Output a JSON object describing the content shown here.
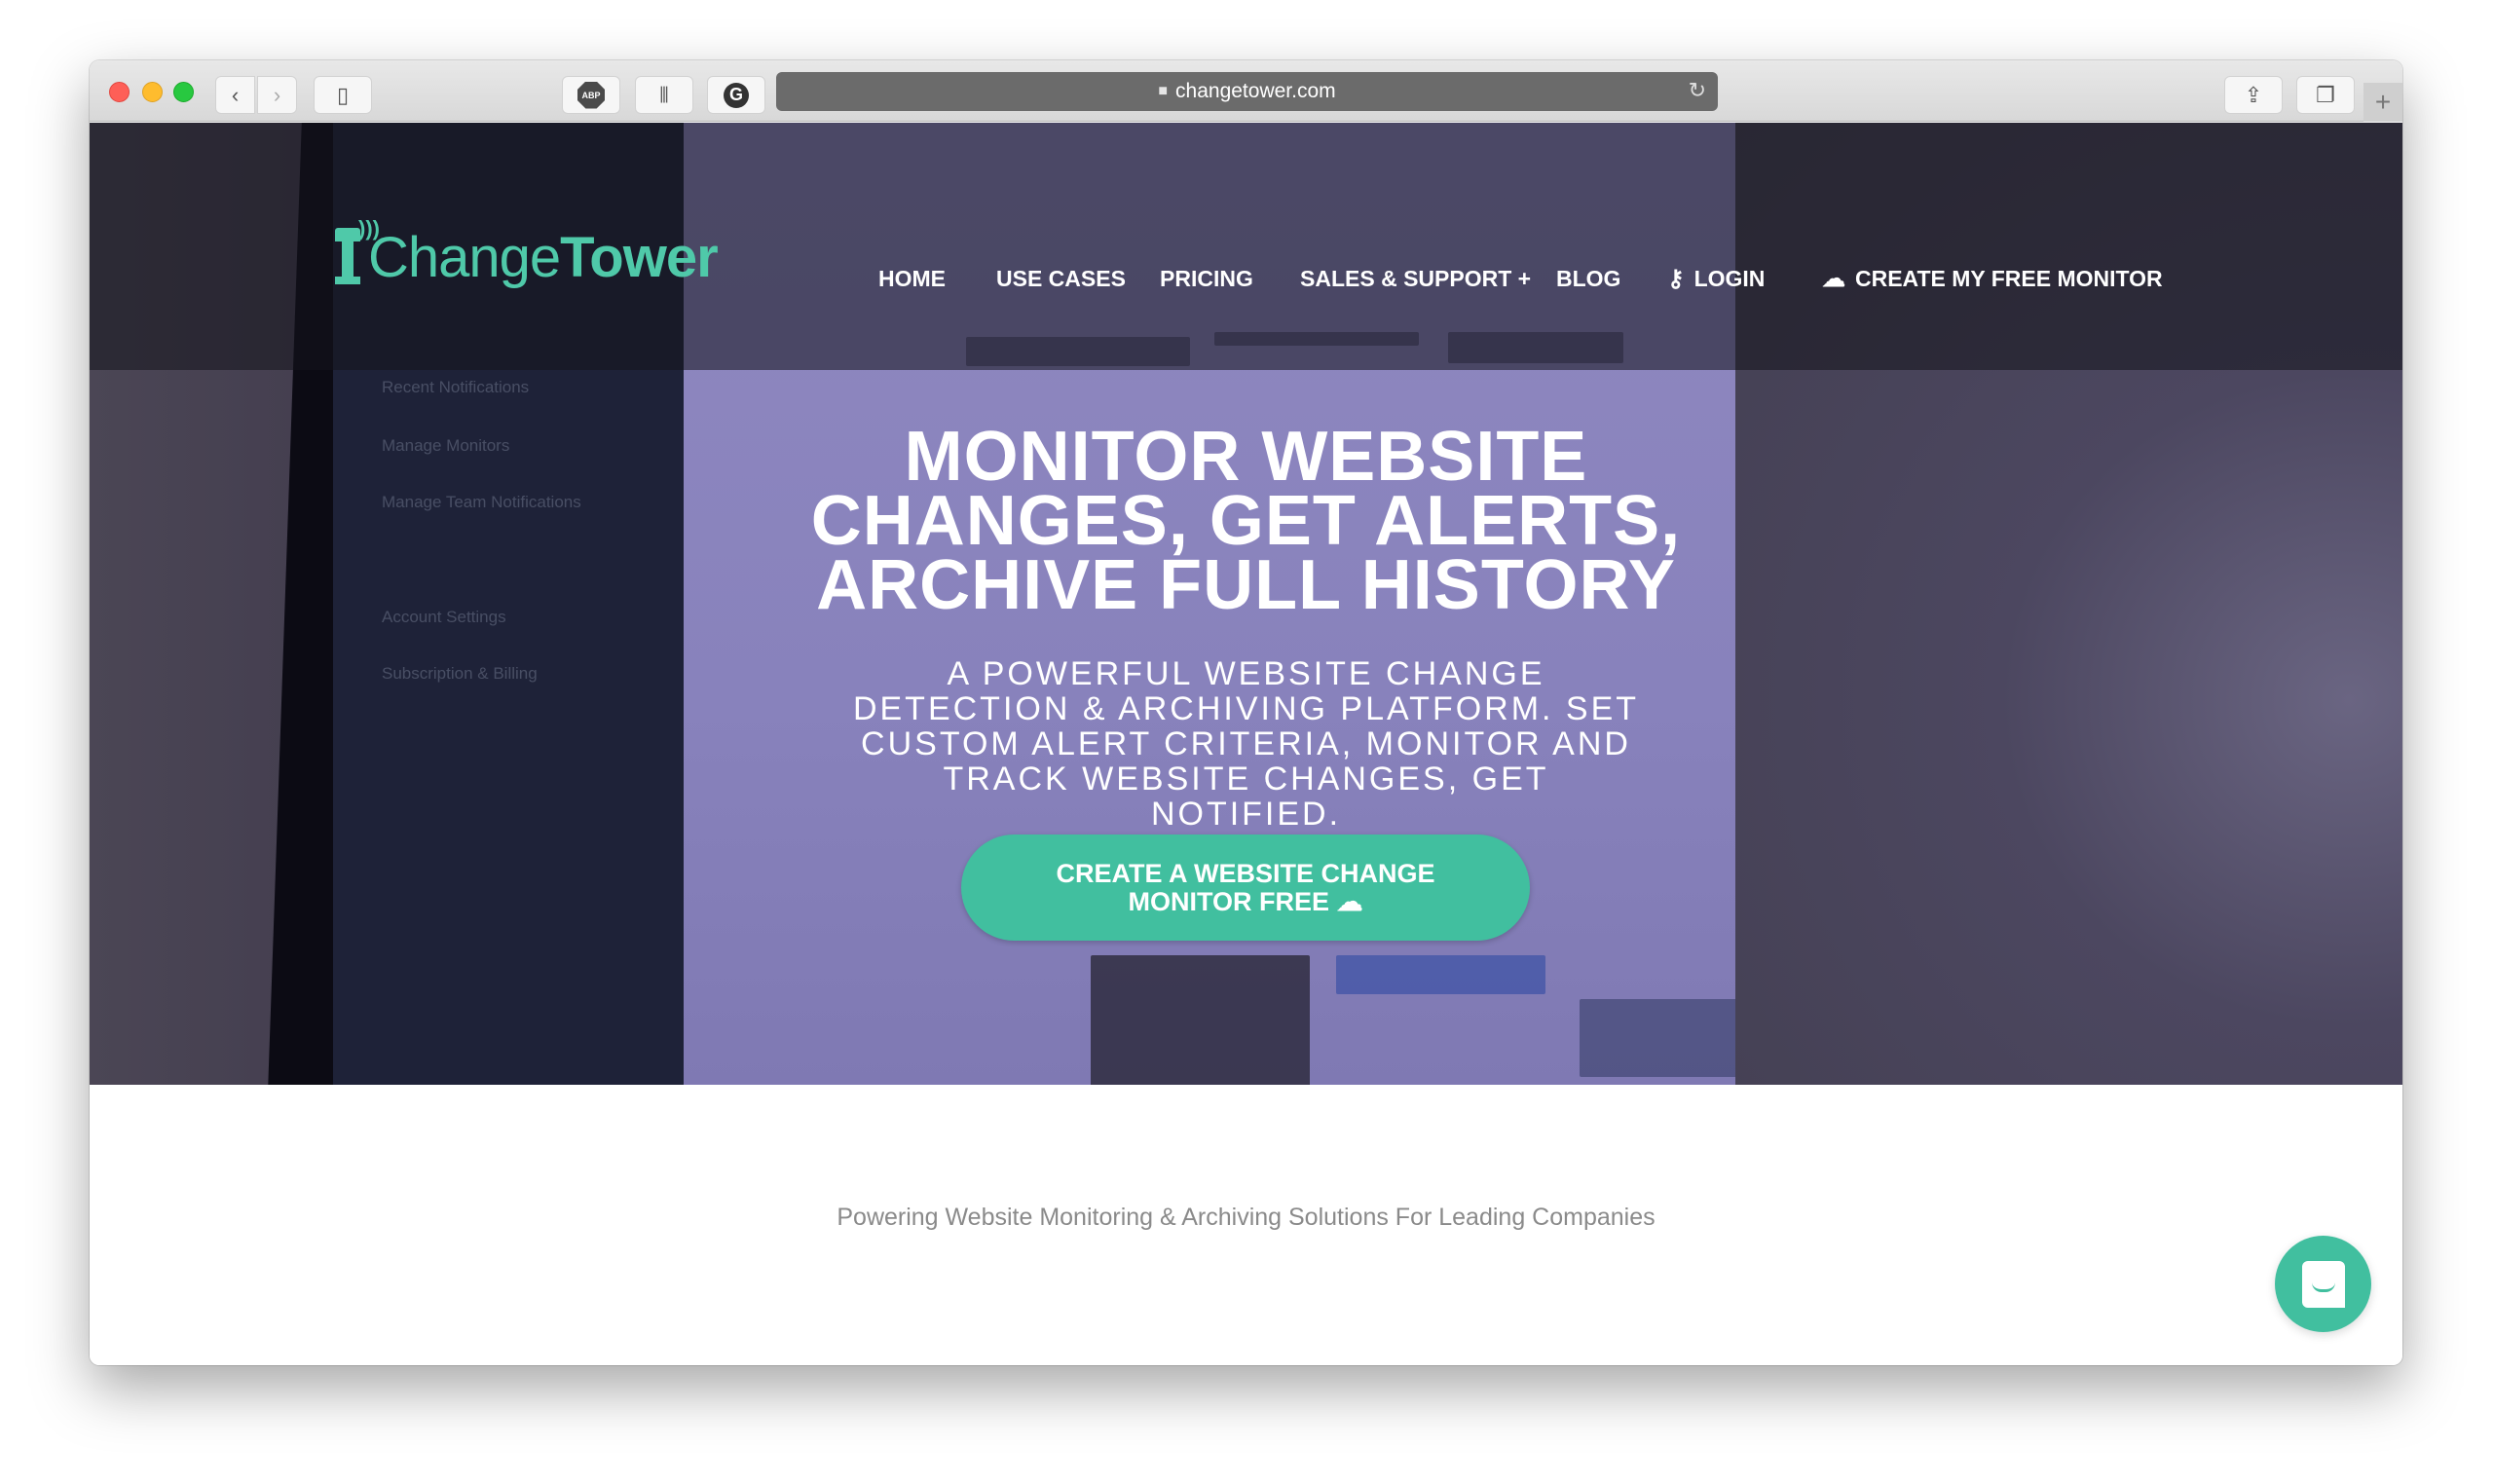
{
  "browser": {
    "url": "changetower.com",
    "toolbar_icons": {
      "back": "chevron-left-icon",
      "forward": "chevron-right-icon",
      "sidebar": "sidebar-icon",
      "adblock": "ABP",
      "extension2": "bar-chart-icon",
      "extension3": "G",
      "share": "share-icon",
      "tabs": "tabs-icon",
      "new_tab": "+"
    },
    "glyphs": {
      "back": "‹",
      "forward": "›",
      "sidebar": "▯",
      "bars": "⦀",
      "share": "⇪",
      "tabs": "❐",
      "lock": "🔒",
      "reload": "↻"
    }
  },
  "site": {
    "logo": {
      "part1": "Change",
      "part2": "Tower",
      "waves": ")))"
    },
    "nav": [
      {
        "label": "HOME"
      },
      {
        "label": "USE CASES"
      },
      {
        "label": "PRICING"
      },
      {
        "label": "SALES & SUPPORT +"
      },
      {
        "label": "BLOG"
      },
      {
        "label": "LOGIN",
        "icon": "⚷"
      },
      {
        "label": "CREATE MY FREE MONITOR",
        "icon": "☁"
      }
    ],
    "hero": {
      "headline": [
        "MONITOR WEBSITE",
        "CHANGES, GET ALERTS,",
        "ARCHIVE FULL HISTORY"
      ],
      "subheadline": [
        "A POWERFUL WEBSITE CHANGE",
        "DETECTION & ARCHIVING PLATFORM. SET",
        "CUSTOM ALERT CRITERIA, MONITOR AND",
        "TRACK WEBSITE CHANGES, GET",
        "NOTIFIED."
      ],
      "cta": {
        "line1": "CREATE A WEBSITE CHANGE",
        "line2": "MONITOR FREE ☁"
      },
      "background_screen_items": [
        "Recent Notifications",
        "Manage Monitors",
        "Manage Team Notifications",
        "Account Settings",
        "Subscription & Billing"
      ]
    },
    "tagline": "Powering Website Monitoring & Archiving Solutions For Leading Companies",
    "colors": {
      "brand": "#4fc9a9",
      "cta": "#41bf9f"
    }
  }
}
